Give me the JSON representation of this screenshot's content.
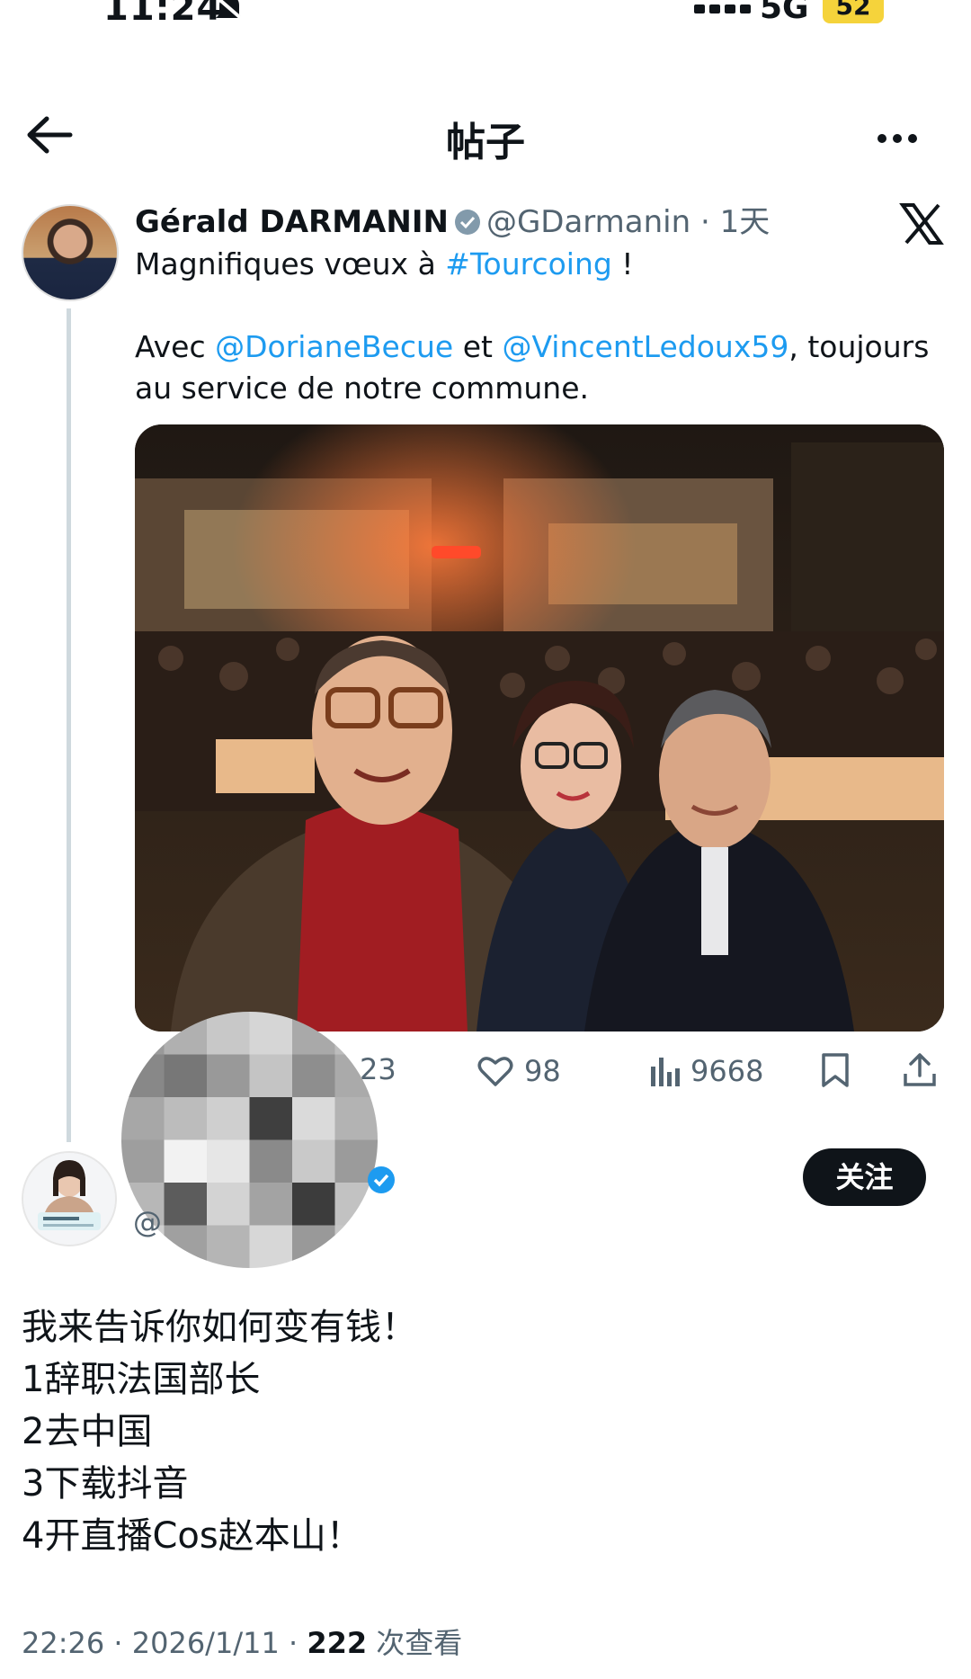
{
  "status_bar": {
    "time": "11:24",
    "network": "5G",
    "battery": "52"
  },
  "header": {
    "title": "帖子"
  },
  "quoted_tweet": {
    "author_name": "Gérald DARMANIN",
    "handle": "@GDarmanin",
    "separator": " · ",
    "age": "1天",
    "text_line1_prefix": "Magnifiques vœux à ",
    "hashtag": "#Tourcoing",
    "text_line1_suffix": " !",
    "text_line2_prefix": "Avec ",
    "mention1": "@DorianeBecue",
    "text_line2_mid": " et ",
    "mention2": "@VincentLedoux59",
    "text_line2_suffix": ", toujours au service de notre commune.",
    "counts": {
      "replies": "23",
      "likes": "98",
      "views": "9668"
    }
  },
  "reply": {
    "handle_prefix": "@",
    "follow_label": "关注",
    "lines": [
      "我来告诉你如何变有钱！",
      "1辞职法国部长",
      "2去中国",
      "3下载抖音",
      "4开直播Cos赵本山！"
    ],
    "meta_time": "22:26 · 2026/1/11 · ",
    "meta_views": "222",
    "meta_views_label": " 次查看"
  },
  "colors": {
    "link": "#1d9bf0",
    "text": "#0f1419",
    "muted": "#536471",
    "battery": "#f5d33b"
  }
}
